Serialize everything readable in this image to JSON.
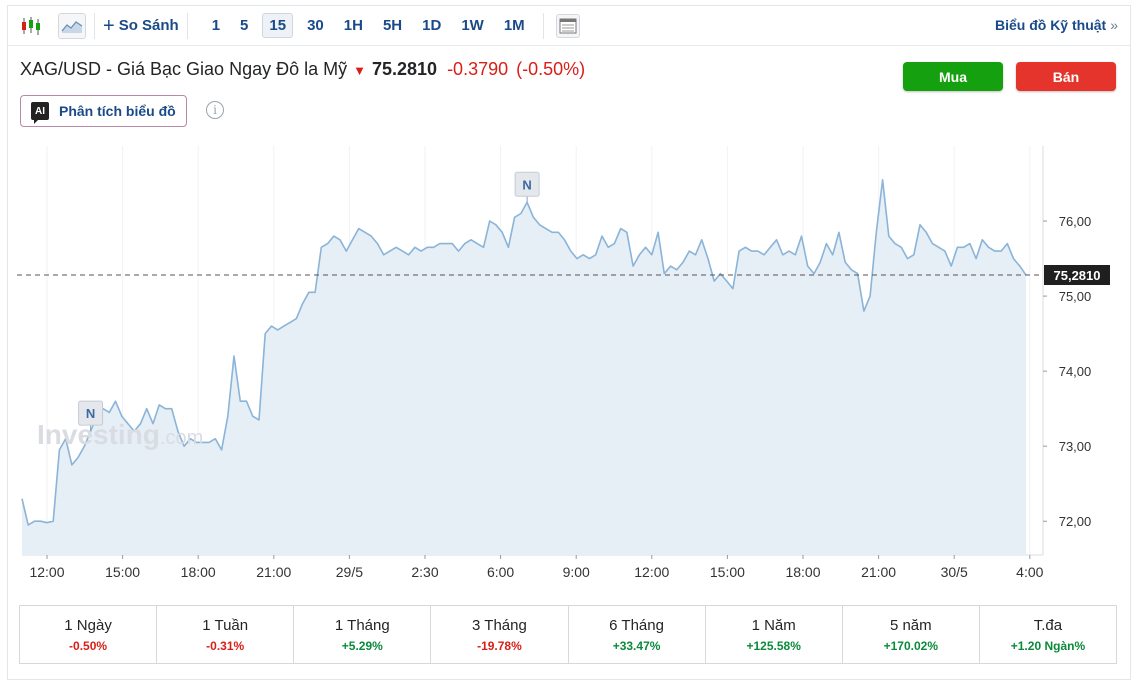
{
  "toolbar": {
    "compare_label": "So Sánh",
    "intervals": [
      "1",
      "5",
      "15",
      "30",
      "1H",
      "5H",
      "1D",
      "1W",
      "1M"
    ],
    "active_interval": "15",
    "tech_chart_label": "Biểu đồ Kỹ thuật",
    "tech_chart_chevron": "»"
  },
  "header": {
    "title": "XAG/USD - Giá Bạc Giao Ngay Đô la Mỹ",
    "price": "75.2810",
    "change": "-0.3790",
    "change_pct": "(-0.50%)",
    "direction": "down",
    "buy_label": "Mua",
    "sell_label": "Bán",
    "ai_badge": "AI",
    "ai_label": "Phân tích biểu đồ",
    "info_glyph": "i"
  },
  "colors": {
    "up": "#0a8a3a",
    "down": "#d91e18",
    "buy": "#15a10f",
    "sell": "#e5342b",
    "line": "#8ab4d8",
    "area": "#e6eef6",
    "link": "#1a4a8a"
  },
  "chart_data": {
    "type": "area",
    "watermark": "Investing.com",
    "y_tick_labels": [
      "72,00",
      "73,00",
      "74,00",
      "75,00",
      "76,00"
    ],
    "y_ticks": [
      72,
      73,
      74,
      75,
      76
    ],
    "ylim": [
      71.55,
      77.0
    ],
    "x_tick_labels": [
      "12:00",
      "15:00",
      "18:00",
      "21:00",
      "29/5",
      "2:30",
      "6:00",
      "9:00",
      "12:00",
      "15:00",
      "18:00",
      "21:00",
      "30/5",
      "4:00"
    ],
    "current_value": 75.281,
    "current_label": "75,2810",
    "news_markers": [
      {
        "label": "N",
        "index": 11
      },
      {
        "label": "N",
        "index": 81
      }
    ],
    "values": [
      72.3,
      71.95,
      72.0,
      72.0,
      71.98,
      72.0,
      72.95,
      73.1,
      72.75,
      72.85,
      73.0,
      73.2,
      73.4,
      73.5,
      73.45,
      73.6,
      73.4,
      73.3,
      73.2,
      73.3,
      73.5,
      73.3,
      73.55,
      73.5,
      73.5,
      73.2,
      73.0,
      73.1,
      73.05,
      73.05,
      73.05,
      73.1,
      72.95,
      73.4,
      74.2,
      73.6,
      73.6,
      73.4,
      73.35,
      74.5,
      74.6,
      74.55,
      74.6,
      74.65,
      74.7,
      74.9,
      75.05,
      75.05,
      75.65,
      75.7,
      75.8,
      75.75,
      75.6,
      75.75,
      75.9,
      75.85,
      75.8,
      75.7,
      75.55,
      75.6,
      75.65,
      75.6,
      75.55,
      75.65,
      75.6,
      75.65,
      75.65,
      75.7,
      75.7,
      75.7,
      75.6,
      75.7,
      75.75,
      75.7,
      75.65,
      76.0,
      75.95,
      75.85,
      75.65,
      76.05,
      76.1,
      76.25,
      76.05,
      75.95,
      75.9,
      75.85,
      75.85,
      75.75,
      75.6,
      75.5,
      75.55,
      75.5,
      75.55,
      75.8,
      75.65,
      75.7,
      75.9,
      75.85,
      75.4,
      75.55,
      75.65,
      75.55,
      75.85,
      75.3,
      75.4,
      75.35,
      75.45,
      75.6,
      75.55,
      75.75,
      75.5,
      75.2,
      75.3,
      75.2,
      75.1,
      75.6,
      75.65,
      75.6,
      75.6,
      75.55,
      75.65,
      75.75,
      75.55,
      75.6,
      75.55,
      75.8,
      75.4,
      75.3,
      75.45,
      75.7,
      75.55,
      75.85,
      75.45,
      75.35,
      75.3,
      74.8,
      75.0,
      75.85,
      76.55,
      75.8,
      75.7,
      75.65,
      75.5,
      75.55,
      75.95,
      75.85,
      75.7,
      75.65,
      75.6,
      75.4,
      75.65,
      75.65,
      75.7,
      75.5,
      75.75,
      75.65,
      75.6,
      75.6,
      75.7,
      75.5,
      75.4,
      75.28
    ],
    "grid": "vertical"
  },
  "performance": [
    {
      "label": "1 Ngày",
      "value": "-0.50%",
      "sign": "neg"
    },
    {
      "label": "1 Tuần",
      "value": "-0.31%",
      "sign": "neg"
    },
    {
      "label": "1 Tháng",
      "value": "+5.29%",
      "sign": "pos"
    },
    {
      "label": "3 Tháng",
      "value": "-19.78%",
      "sign": "neg"
    },
    {
      "label": "6 Tháng",
      "value": "+33.47%",
      "sign": "pos"
    },
    {
      "label": "1 Năm",
      "value": "+125.58%",
      "sign": "pos"
    },
    {
      "label": "5 năm",
      "value": "+170.02%",
      "sign": "pos"
    },
    {
      "label": "T.đa",
      "value": "+1.20 Ngàn%",
      "sign": "pos"
    }
  ]
}
